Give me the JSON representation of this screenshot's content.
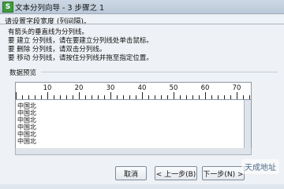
{
  "window": {
    "title": "文本分列向导 - 3 步骤之 1",
    "subtitle": "请设置字段宽度 (列间隔)。"
  },
  "instructions": {
    "header": "有箭头的垂直线为分列线。",
    "lines": [
      {
        "verb": "要  建立",
        "text": "分列线，请在要建立分列线处单击鼠标。"
      },
      {
        "verb": "要  删除",
        "text": "分列线，请双击分列线。"
      },
      {
        "verb": "要  移动",
        "text": "分列线，请按住分列线并拖至指定位置。"
      }
    ]
  },
  "preview": {
    "label": "数据预览",
    "ruler_ticks": [
      "10",
      "20",
      "30",
      "40",
      "50",
      "60",
      "70"
    ],
    "rows": [
      "中国北",
      "中国北",
      "中国北",
      "中国北",
      "中国北",
      "中国北"
    ]
  },
  "buttons": {
    "cancel": "取消",
    "back": "< 上一步(B)",
    "next": "下一步(N) >"
  },
  "watermark": "天成地址"
}
